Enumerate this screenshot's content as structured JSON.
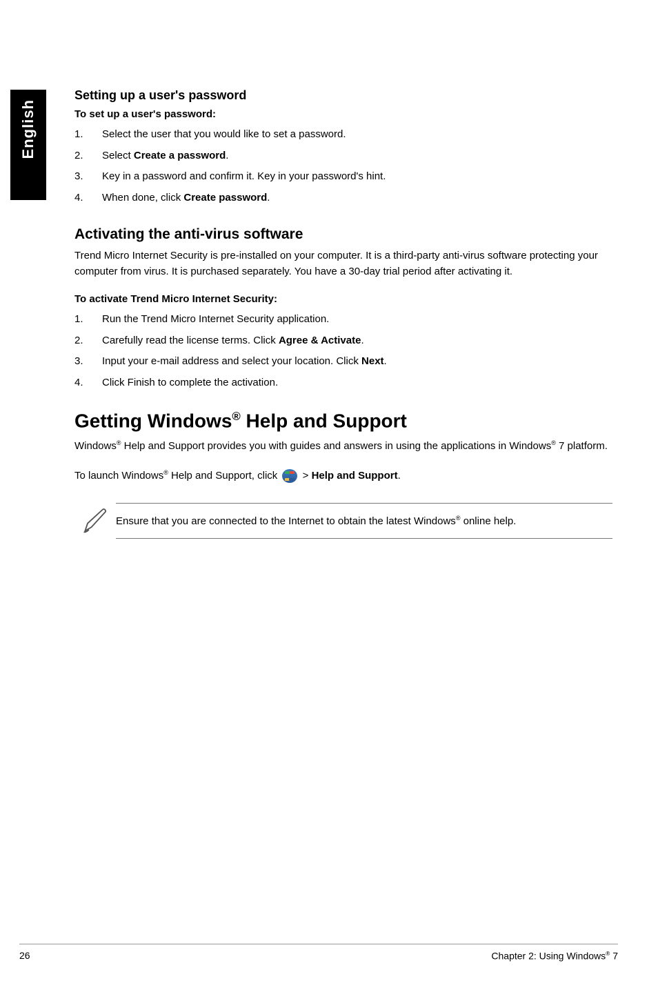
{
  "sidebar": {
    "language": "English"
  },
  "section1": {
    "heading": "Setting up a user's password",
    "sub": "To set up a user's password:",
    "steps": [
      {
        "n": "1.",
        "t": "Select the user that you would like to set a password."
      },
      {
        "n": "2.",
        "pre": "Select ",
        "bold": "Create a password",
        "post": "."
      },
      {
        "n": "3.",
        "t": "Key in a password and confirm it. Key in your password's hint."
      },
      {
        "n": "4.",
        "pre": "When done, click ",
        "bold": "Create password",
        "post": "."
      }
    ]
  },
  "section2": {
    "heading": "Activating the anti-virus software",
    "para": "Trend Micro Internet Security is pre-installed on your computer. It is a third-party anti-virus software protecting your computer from virus. It is purchased separately. You have a 30-day trial period after activating it.",
    "sub": "To activate Trend Micro Internet Security:",
    "steps": [
      {
        "n": "1.",
        "t": "Run the Trend Micro Internet Security application."
      },
      {
        "n": "2.",
        "pre": "Carefully read the license terms. Click ",
        "bold": "Agree & Activate",
        "post": "."
      },
      {
        "n": "3.",
        "pre": "Input your e-mail address and select your location. Click ",
        "bold": "Next",
        "post": "."
      },
      {
        "n": "4.",
        "t": "Click Finish to complete the activation."
      }
    ]
  },
  "section3": {
    "heading_pre": "Getting Windows",
    "heading_post": " Help and Support",
    "para_pre": "Windows",
    "para_mid1": " Help and Support provides you with guides and answers in using the applications in Windows",
    "para_post": " 7 platform.",
    "launch_pre": "To launch Windows",
    "launch_mid": " Help and Support, click ",
    "launch_gt": " > ",
    "launch_bold": "Help and Support",
    "launch_post": ".",
    "note_pre": "Ensure that you are connected to the Internet to obtain the latest Windows",
    "note_post": " online help."
  },
  "footer": {
    "page": "26",
    "chapter_pre": "Chapter 2: Using Windows",
    "chapter_post": " 7"
  },
  "reg": "®"
}
